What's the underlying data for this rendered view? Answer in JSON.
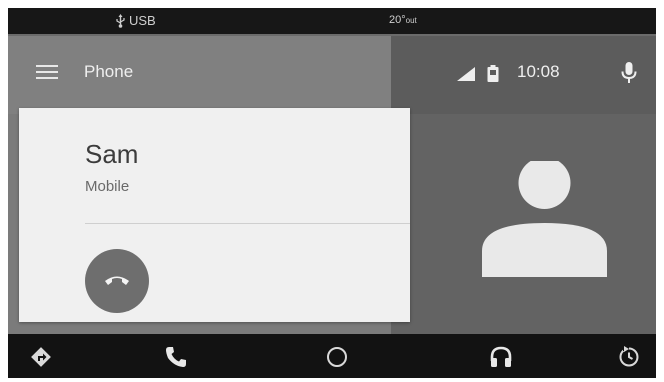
{
  "status_bar": {
    "usb_label": "USB",
    "temperature": "20°",
    "temperature_suffix": "out"
  },
  "app_bar": {
    "title": "Phone",
    "time": "10:08"
  },
  "call": {
    "caller_name": "Sam",
    "caller_type": "Mobile"
  },
  "icons": {
    "menu": "menu-icon",
    "signal": "signal-icon",
    "battery": "battery-icon",
    "mic": "mic-icon",
    "hangup": "hang-up-icon",
    "avatar": "contact-avatar",
    "nav": [
      "navigation-icon",
      "phone-icon",
      "home-icon",
      "audio-icon",
      "recents-icon"
    ]
  },
  "colors": {
    "status_bar": "#171717",
    "app_bar_left": "#808080",
    "app_bar_right": "#5c5c5c",
    "card": "#f0f0f0",
    "hangup_button": "#6e6e6e",
    "nav_bar": "#121212"
  }
}
